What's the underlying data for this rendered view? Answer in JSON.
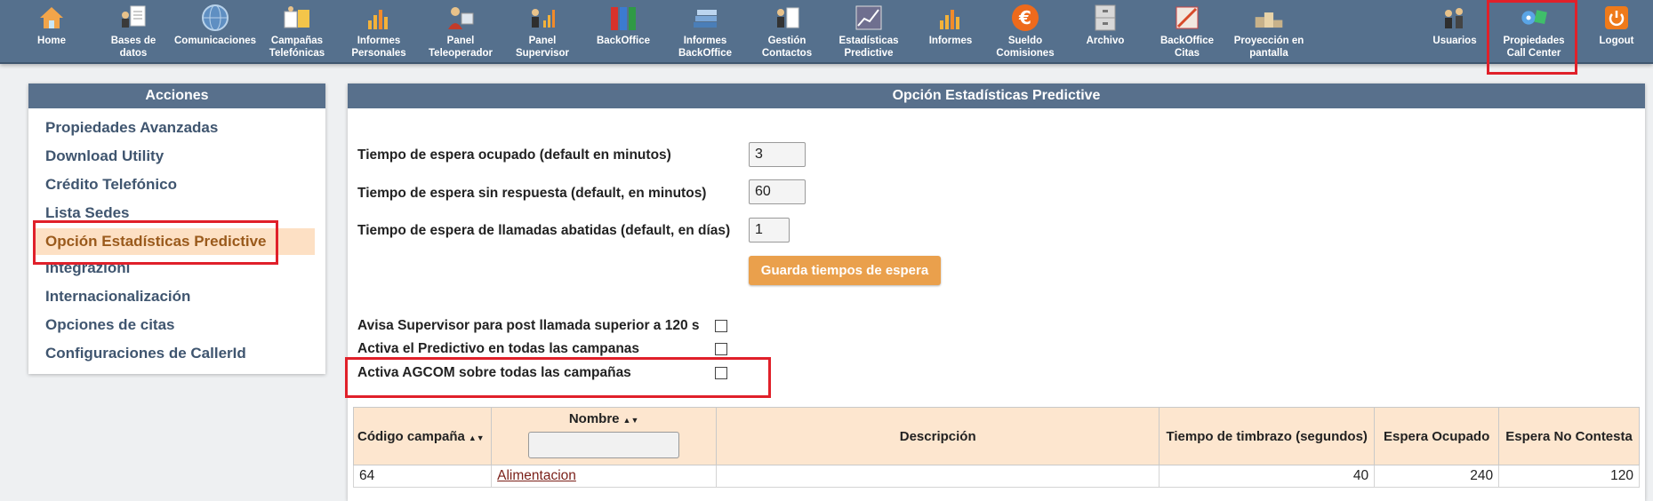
{
  "toolbar": {
    "items": [
      {
        "label": "Home",
        "icon": "home-icon"
      },
      {
        "label": "Bases de\ndatos",
        "icon": "database-icon"
      },
      {
        "label": "Comunicaciones",
        "icon": "globe-icon"
      },
      {
        "label": "Campañas\nTelefónicas",
        "icon": "campaign-icon"
      },
      {
        "label": "Informes\nPersonales",
        "icon": "bar-chart-icon"
      },
      {
        "label": "Panel\nTeleoperador",
        "icon": "operator-icon"
      },
      {
        "label": "Panel\nSupervisor",
        "icon": "supervisor-icon"
      },
      {
        "label": "BackOffice",
        "icon": "binders-icon"
      },
      {
        "label": "Informes\nBackOffice",
        "icon": "stack-icon"
      },
      {
        "label": "Gestión\nContactos",
        "icon": "contacts-icon"
      },
      {
        "label": "Estadísticas\nPredictive",
        "icon": "line-chart-icon"
      },
      {
        "label": "Informes",
        "icon": "bar-chart-icon"
      },
      {
        "label": "Sueldo\nComisiones",
        "icon": "euro-icon"
      },
      {
        "label": "Archivo",
        "icon": "cabinet-icon"
      },
      {
        "label": "BackOffice\nCitas",
        "icon": "calendar-icon"
      },
      {
        "label": "Proyección en\npantalla",
        "icon": "podium-icon"
      }
    ],
    "right_items": [
      {
        "label": "Usuarios",
        "icon": "users-icon"
      },
      {
        "label": "Propiedades\nCall Center",
        "icon": "gears-icon"
      },
      {
        "label": "Logout",
        "icon": "power-icon"
      }
    ]
  },
  "sidebar": {
    "title": "Acciones",
    "items": [
      {
        "label": "Propiedades Avanzadas"
      },
      {
        "label": "Download Utility"
      },
      {
        "label": "Crédito Telefónico"
      },
      {
        "label": "Lista Sedes"
      },
      {
        "label": "Opción Estadísticas Predictive"
      },
      {
        "label": "Integrazioni"
      },
      {
        "label": "Internacionalización"
      },
      {
        "label": "Opciones de citas"
      },
      {
        "label": "Configuraciones de CallerId"
      }
    ]
  },
  "main": {
    "title": "Opción Estadísticas Predictive",
    "fields": [
      {
        "label": "Tiempo de espera ocupado (default en minutos)",
        "value": "3"
      },
      {
        "label": "Tiempo de espera sin respuesta (default, en minutos)",
        "value": "60"
      },
      {
        "label": "Tiempo de espera de llamadas abatidas (default, en días)",
        "value": "1"
      }
    ],
    "save_label": "Guarda tiempos de espera",
    "checks": [
      {
        "label": "Avisa Supervisor para post llamada superior a 120 s",
        "checked": false
      },
      {
        "label": "Activa el Predictivo en todas las campanas",
        "checked": false
      },
      {
        "label": "Activa AGCOM sobre todas las campañas",
        "checked": false
      }
    ],
    "table": {
      "headers": [
        "Código campaña",
        "Nombre",
        "Descripción",
        "Tiempo de timbrazo (segundos)",
        "Espera Ocupado",
        "Espera No Contesta"
      ],
      "rows": [
        [
          "64",
          "Alimentacion",
          "",
          "40",
          "240",
          "120"
        ]
      ]
    }
  },
  "colors": {
    "toolbar_bg": "#55708d",
    "panel_header": "#58708c",
    "accent_orange": "#eaa04c",
    "highlight": "#e0202a"
  }
}
